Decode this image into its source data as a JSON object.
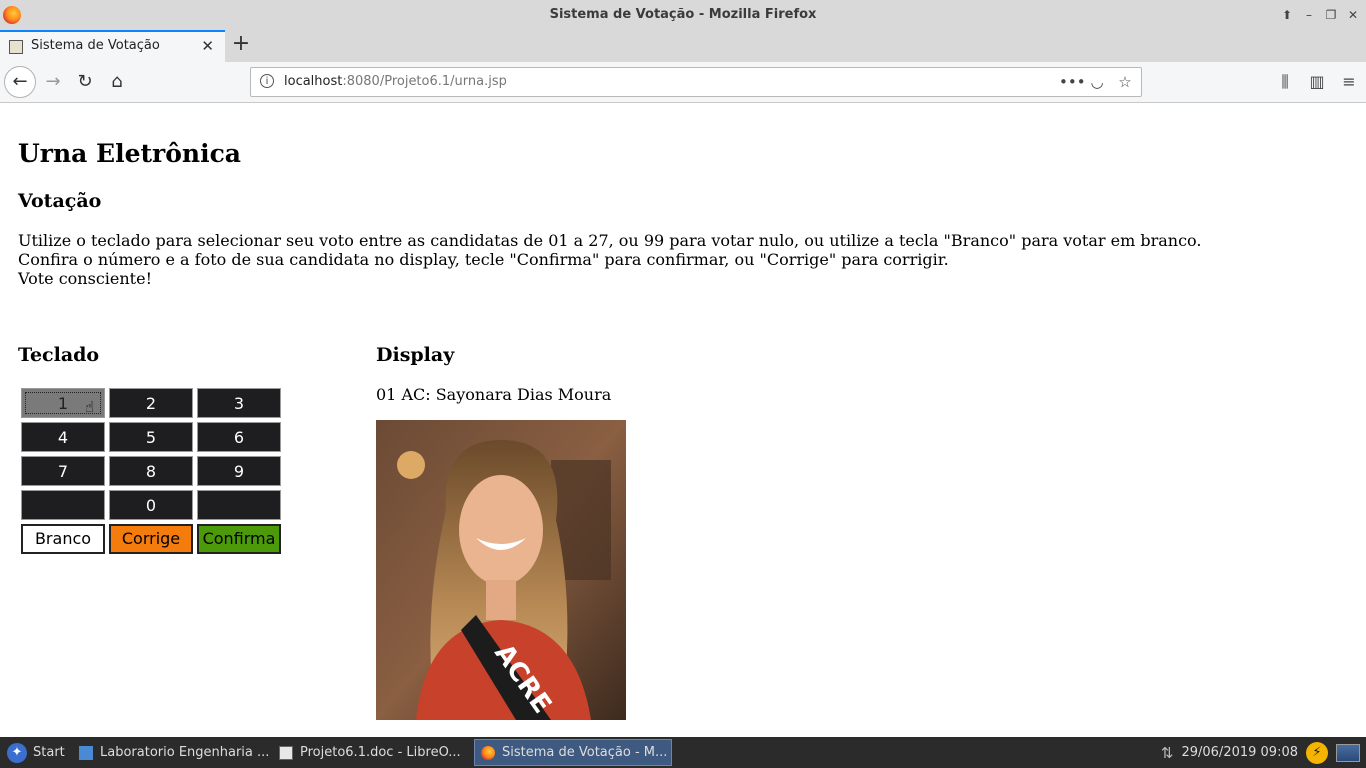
{
  "window": {
    "title": "Sistema de Votação - Mozilla Firefox"
  },
  "tab": {
    "label": "Sistema de Votação"
  },
  "url": {
    "host": "localhost",
    "rest": ":8080/Projeto6.1/urna.jsp"
  },
  "page": {
    "title": "Urna Eletrônica",
    "section_voting": "Votação",
    "intro_lines": [
      "Utilize o teclado para selecionar seu voto entre as candidatas de 01 a 27, ou 99 para votar nulo, ou utilize a tecla \"Branco\" para votar em branco.",
      "Confira o número e a foto de sua candidata no display, tecle \"Confirma\" para confirmar, ou \"Corrige\" para corrigir.",
      "Vote consciente!"
    ],
    "keypad_heading": "Teclado",
    "keys": [
      "1",
      "2",
      "3",
      "4",
      "5",
      "6",
      "7",
      "8",
      "9",
      "",
      "0",
      ""
    ],
    "branco_label": "Branco",
    "corrige_label": "Corrige",
    "confirma_label": "Confirma",
    "display_heading": "Display",
    "display_text": "01 AC: Sayonara Dias Moura",
    "sash_text": "ACRE"
  },
  "taskbar": {
    "start": "Start",
    "items": [
      "Laboratorio Engenharia ...",
      "Projeto6.1.doc - LibreO...",
      "Sistema de Votação - M..."
    ],
    "datetime": "29/06/2019 09:08"
  },
  "colors": {
    "corrige": "#f47c0c",
    "confirma": "#4c9a0a",
    "key": "#1e1e20",
    "accent_tab": "#0a84ff"
  }
}
